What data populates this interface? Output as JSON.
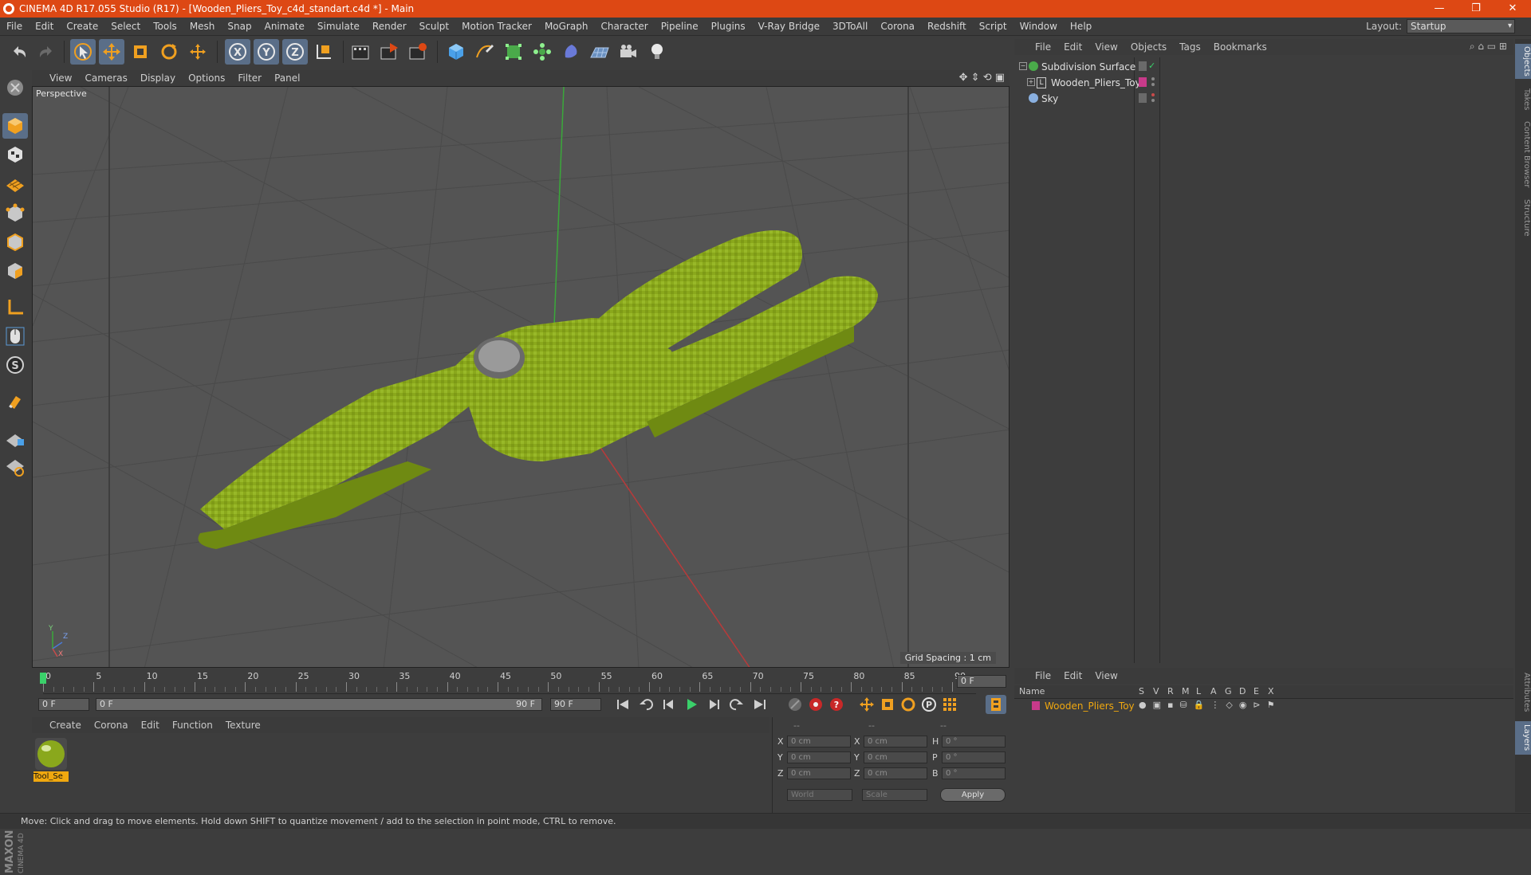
{
  "window": {
    "title": "CINEMA 4D R17.055 Studio (R17) - [Wooden_Pliers_Toy_c4d_standart.c4d *] - Main",
    "controls": [
      "—",
      "❐",
      "✕"
    ]
  },
  "menubar": {
    "items": [
      "File",
      "Edit",
      "Create",
      "Select",
      "Tools",
      "Mesh",
      "Snap",
      "Animate",
      "Simulate",
      "Render",
      "Sculpt",
      "Motion Tracker",
      "MoGraph",
      "Character",
      "Pipeline",
      "Plugins",
      "V-Ray Bridge",
      "3DToAll",
      "Corona",
      "Redshift",
      "Script",
      "Window",
      "Help"
    ],
    "layout_label": "Layout:",
    "layout_value": "Startup"
  },
  "viewport": {
    "menu": [
      "View",
      "Cameras",
      "Display",
      "Options",
      "Filter",
      "Panel"
    ],
    "label": "Perspective",
    "grid_spacing": "Grid Spacing : 1 cm",
    "axis_labels": [
      "Y",
      "Z",
      "X"
    ]
  },
  "timeline": {
    "ticks": [
      "0",
      "5",
      "10",
      "15",
      "20",
      "25",
      "30",
      "35",
      "40",
      "45",
      "50",
      "55",
      "60",
      "65",
      "70",
      "75",
      "80",
      "85",
      "90"
    ],
    "end_field": "0 F",
    "start_field": "0 F",
    "range_start": "0 F",
    "range_end": "90 F",
    "max_field": "90 F"
  },
  "material_manager": {
    "menu": [
      "Create",
      "Corona",
      "Edit",
      "Function",
      "Texture"
    ],
    "materials": [
      {
        "name": "Tool_Se"
      }
    ]
  },
  "coordinates": {
    "header": [
      "--",
      "--",
      "--"
    ],
    "rows": [
      {
        "a": "X",
        "av": "0 cm",
        "b": "X",
        "bv": "0 cm",
        "c": "H",
        "cv": "0 °"
      },
      {
        "a": "Y",
        "av": "0 cm",
        "b": "Y",
        "bv": "0 cm",
        "c": "P",
        "cv": "0 °"
      },
      {
        "a": "Z",
        "av": "0 cm",
        "b": "Z",
        "bv": "0 cm",
        "c": "B",
        "cv": "0 °"
      }
    ],
    "mode": "World",
    "transform": "Scale",
    "apply": "Apply"
  },
  "object_manager": {
    "menu": [
      "File",
      "Edit",
      "View",
      "Objects",
      "Tags",
      "Bookmarks"
    ],
    "objects": [
      {
        "name": "Subdivision Surface",
        "indent": 0
      },
      {
        "name": "Wooden_Pliers_Toy",
        "indent": 1
      },
      {
        "name": "Sky",
        "indent": 0
      }
    ]
  },
  "layer_manager": {
    "menu": [
      "File",
      "Edit",
      "View"
    ],
    "columns": [
      "Name",
      "S",
      "V",
      "R",
      "M",
      "L",
      "A",
      "G",
      "D",
      "E",
      "X"
    ],
    "layers": [
      {
        "name": "Wooden_Pliers_Toy"
      }
    ]
  },
  "right_tabs": [
    "Objects",
    "Takes",
    "Content Browser",
    "Structure",
    "Attributes",
    "Layers"
  ],
  "brand": "MAXON CINEMA 4D",
  "status": "Move: Click and drag to move elements. Hold down SHIFT to quantize movement / add to the selection in point mode, CTRL to remove.",
  "colors": {
    "titlebar": "#dd4814",
    "model": "#8aa81c",
    "layer_text": "#f0a80f",
    "active_tool": "#5a6e88"
  }
}
